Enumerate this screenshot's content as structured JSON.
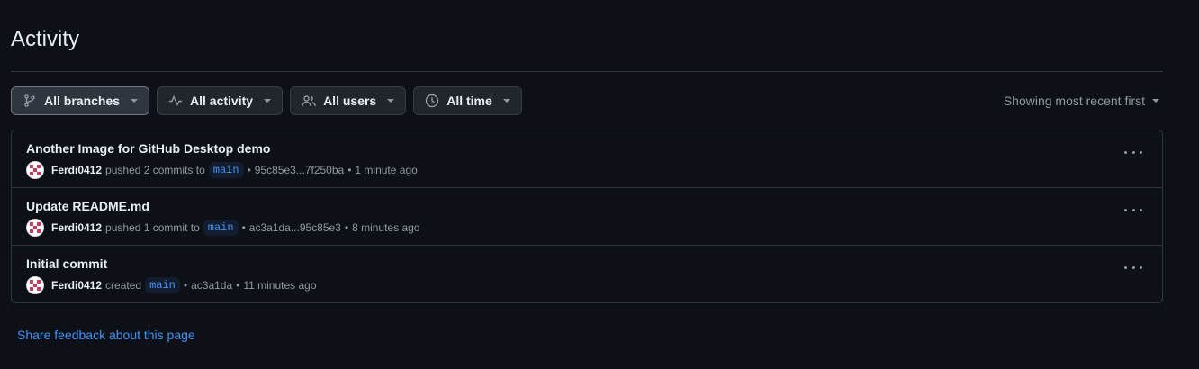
{
  "page_title": "Activity",
  "filters": [
    {
      "label": "All branches",
      "icon": "git-branch-icon"
    },
    {
      "label": "All activity",
      "icon": "pulse-icon"
    },
    {
      "label": "All users",
      "icon": "people-icon"
    },
    {
      "label": "All time",
      "icon": "clock-icon"
    }
  ],
  "sort_label": "Showing most recent first",
  "activities": [
    {
      "title": "Another Image for GitHub Desktop demo",
      "user": "Ferdi0412",
      "action": "pushed 2 commits to",
      "branch": "main",
      "sep1": "•",
      "commits": "95c85e3...7f250ba",
      "sep2": "•",
      "time": "1 minute ago"
    },
    {
      "title": "Update README.md",
      "user": "Ferdi0412",
      "action": "pushed 1 commit to",
      "branch": "main",
      "sep1": "•",
      "commits": "ac3a1da...95c85e3",
      "sep2": "•",
      "time": "8 minutes ago"
    },
    {
      "title": "Initial commit",
      "user": "Ferdi0412",
      "action": "created",
      "branch": "main",
      "sep1": "•",
      "commits": "ac3a1da",
      "sep2": "•",
      "time": "11 minutes ago"
    }
  ],
  "feedback_link": "Share feedback about this page",
  "colors": {
    "background": "#0d1117",
    "link": "#4493f8",
    "muted": "#9198a1",
    "border": "#30363d"
  }
}
